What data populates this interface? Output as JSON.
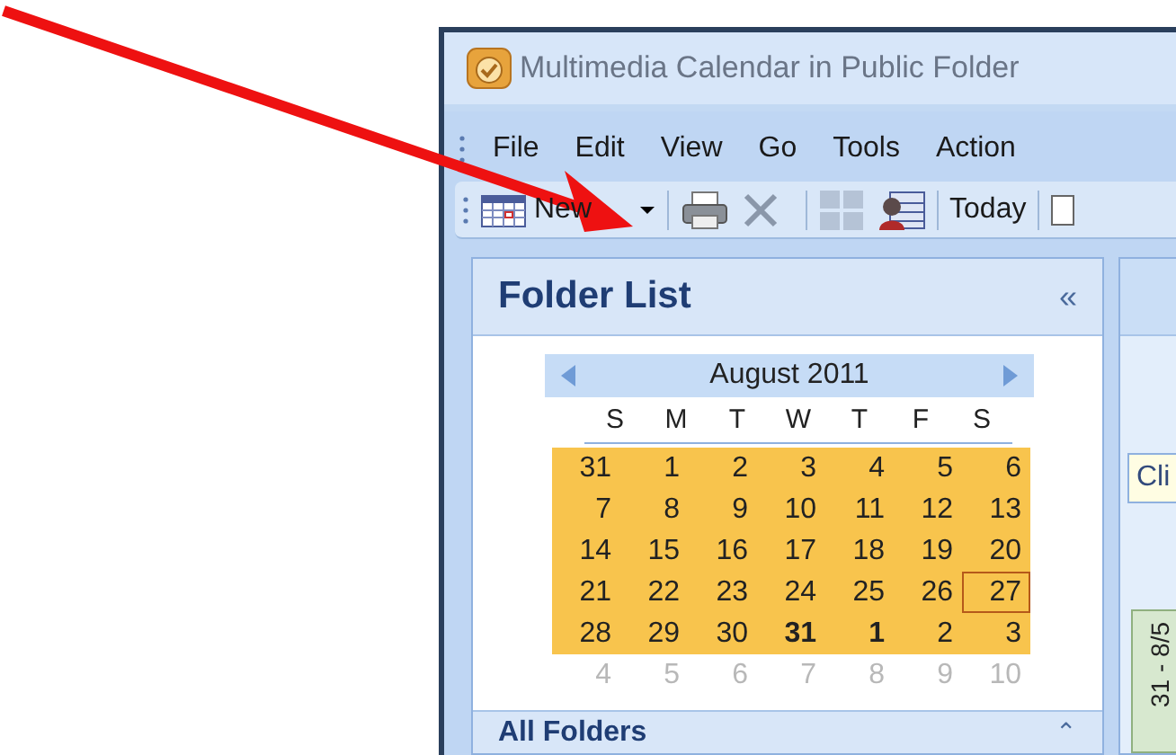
{
  "window": {
    "title": "Multimedia Calendar in Public Folder"
  },
  "menu": [
    "File",
    "Edit",
    "View",
    "Go",
    "Tools",
    "Action"
  ],
  "toolbar": {
    "new_label": "New",
    "today_label": "Today"
  },
  "folder_pane": {
    "title": "Folder List",
    "collapse": "«",
    "calendar": {
      "month": "August 2011",
      "weekdays": [
        "S",
        "M",
        "T",
        "W",
        "T",
        "F",
        "S"
      ],
      "weeks": [
        {
          "selected": true,
          "days": [
            {
              "text": "31",
              "bold": false,
              "today": false
            },
            {
              "text": "1",
              "bold": false,
              "today": false
            },
            {
              "text": "2",
              "bold": false,
              "today": false
            },
            {
              "text": "3",
              "bold": false,
              "today": false
            },
            {
              "text": "4",
              "bold": false,
              "today": false
            },
            {
              "text": "5",
              "bold": false,
              "today": false
            },
            {
              "text": "6",
              "bold": false,
              "today": false
            }
          ]
        },
        {
          "selected": true,
          "days": [
            {
              "text": "7",
              "bold": false,
              "today": false
            },
            {
              "text": "8",
              "bold": false,
              "today": false
            },
            {
              "text": "9",
              "bold": false,
              "today": false
            },
            {
              "text": "10",
              "bold": false,
              "today": false
            },
            {
              "text": "11",
              "bold": false,
              "today": false
            },
            {
              "text": "12",
              "bold": false,
              "today": false
            },
            {
              "text": "13",
              "bold": false,
              "today": false
            }
          ]
        },
        {
          "selected": true,
          "days": [
            {
              "text": "14",
              "bold": false,
              "today": false
            },
            {
              "text": "15",
              "bold": false,
              "today": false
            },
            {
              "text": "16",
              "bold": false,
              "today": false
            },
            {
              "text": "17",
              "bold": false,
              "today": false
            },
            {
              "text": "18",
              "bold": false,
              "today": false
            },
            {
              "text": "19",
              "bold": false,
              "today": false
            },
            {
              "text": "20",
              "bold": false,
              "today": false
            }
          ]
        },
        {
          "selected": true,
          "days": [
            {
              "text": "21",
              "bold": false,
              "today": false
            },
            {
              "text": "22",
              "bold": false,
              "today": false
            },
            {
              "text": "23",
              "bold": false,
              "today": false
            },
            {
              "text": "24",
              "bold": false,
              "today": false
            },
            {
              "text": "25",
              "bold": false,
              "today": false
            },
            {
              "text": "26",
              "bold": false,
              "today": false
            },
            {
              "text": "27",
              "bold": false,
              "today": true
            }
          ]
        },
        {
          "selected": true,
          "days": [
            {
              "text": "28",
              "bold": false,
              "today": false
            },
            {
              "text": "29",
              "bold": false,
              "today": false
            },
            {
              "text": "30",
              "bold": false,
              "today": false
            },
            {
              "text": "31",
              "bold": true,
              "today": false
            },
            {
              "text": "1",
              "bold": true,
              "today": false
            },
            {
              "text": "2",
              "bold": false,
              "today": false
            },
            {
              "text": "3",
              "bold": false,
              "today": false
            }
          ]
        },
        {
          "selected": false,
          "days": [
            {
              "text": "4",
              "bold": false,
              "today": false
            },
            {
              "text": "5",
              "bold": false,
              "today": false
            },
            {
              "text": "6",
              "bold": false,
              "today": false
            },
            {
              "text": "7",
              "bold": false,
              "today": false
            },
            {
              "text": "8",
              "bold": false,
              "today": false
            },
            {
              "text": "9",
              "bold": false,
              "today": false
            },
            {
              "text": "10",
              "bold": false,
              "today": false
            }
          ]
        }
      ]
    },
    "section": {
      "title": "All Folders",
      "toggle": "⌃"
    }
  },
  "view_pane": {
    "tooltip": "Cli",
    "week_tab": "31 - 8/5"
  }
}
